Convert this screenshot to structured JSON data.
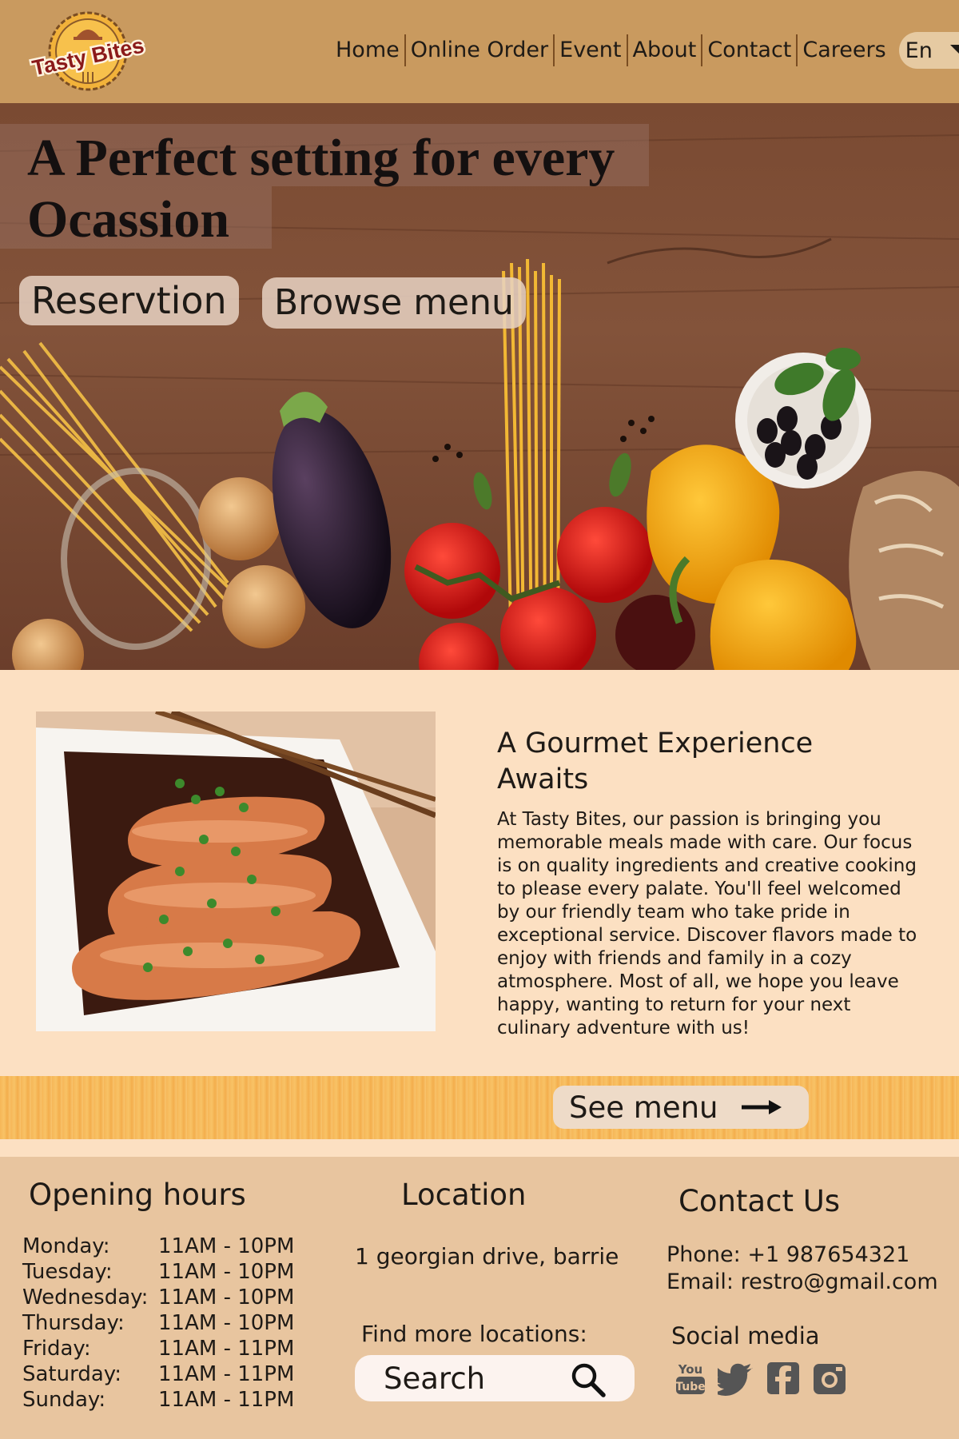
{
  "header": {
    "logo_text": "Tasty Bites",
    "nav": [
      "Home",
      "Online Order",
      "Event",
      "About",
      "Contact",
      "Careers"
    ],
    "language": "En"
  },
  "hero": {
    "title_line1": "A Perfect setting for every",
    "title_line2": "Ocassion",
    "reservation_label": "Reservtion",
    "browse_label": "Browse menu"
  },
  "about": {
    "title": "A Gourmet Experience Awaits",
    "text": "At Tasty Bites, our passion is bringing you memorable meals made with care. Our focus is on quality ingredients and creative cooking to please every palate. You'll feel welcomed by our friendly team who take pride in exceptional service. Discover flavors made to enjoy with friends and family in a cozy atmosphere. Most of all, we hope you leave happy, wanting to return for your next culinary adventure with us!"
  },
  "strip": {
    "see_menu_label": "See menu"
  },
  "footer": {
    "hours_title": "Opening hours",
    "hours": [
      {
        "day": "Monday:",
        "time": "11AM - 10PM"
      },
      {
        "day": "Tuesday:",
        "time": "11AM - 10PM"
      },
      {
        "day": "Wednesday:",
        "time": "11AM - 10PM"
      },
      {
        "day": "Thursday:",
        "time": "11AM - 10PM"
      },
      {
        "day": "Friday:",
        "time": "11AM - 11PM"
      },
      {
        "day": "Saturday:",
        "time": "11AM - 11PM"
      },
      {
        "day": "Sunday:",
        "time": "11AM - 11PM"
      }
    ],
    "location_title": "Location",
    "address": "1 georgian drive, barrie",
    "find_more": "Find more locations:",
    "search_placeholder": "Search",
    "contact_title": "Contact Us",
    "phone": "Phone: +1 987654321",
    "email": "Email: restro@gmail.com",
    "social_title": "Social media",
    "social_icons": [
      "youtube-icon",
      "twitter-icon",
      "facebook-icon",
      "instagram-icon"
    ]
  },
  "colors": {
    "header_bg": "#c99a5f",
    "page_bg": "#fce0c2",
    "footer_bg": "#e8c59f",
    "strip_bg": "#f6b758"
  }
}
